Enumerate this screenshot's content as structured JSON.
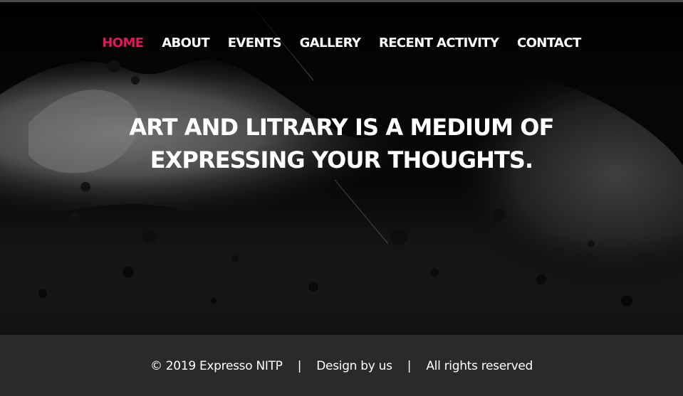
{
  "nav": {
    "items": [
      {
        "label": "HOME",
        "active": true
      },
      {
        "label": "ABOUT",
        "active": false
      },
      {
        "label": "EVENTS",
        "active": false
      },
      {
        "label": "GALLERY",
        "active": false
      },
      {
        "label": "RECENT ACTIVITY",
        "active": false
      },
      {
        "label": "CONTACT",
        "active": false
      }
    ],
    "active_color": "#e2175d",
    "text_color": "#ffffff"
  },
  "hero": {
    "headline_line1": "ART AND LITRARY IS A MEDIUM OF",
    "headline_line2": "EXPRESSING YOUR THOUGHTS.",
    "background": "ink-splash-texture"
  },
  "footer": {
    "copyright": "© 2019 Expresso NITP",
    "separator": "|",
    "design": "Design by us",
    "rights": "All rights reserved",
    "background_color": "#2b2a2b"
  }
}
